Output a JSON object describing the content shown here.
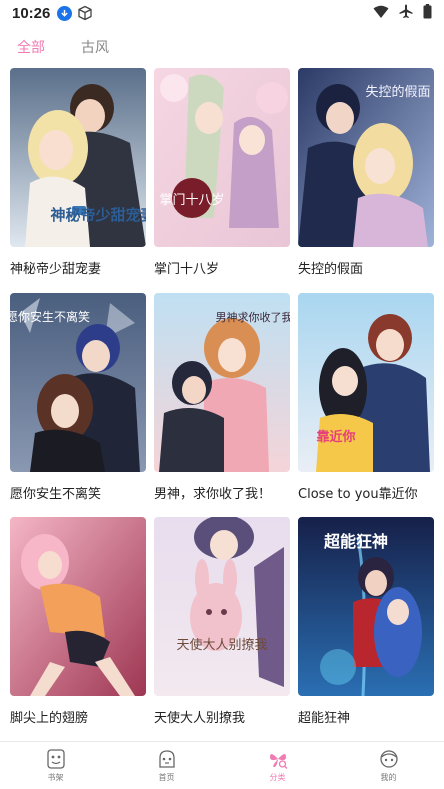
{
  "status_bar": {
    "time": "10:26",
    "icons": [
      "download-icon",
      "box-icon",
      "wifi-icon",
      "airplane-icon",
      "battery-icon"
    ]
  },
  "tabs": [
    {
      "label": "全部",
      "active": true
    },
    {
      "label": "古风",
      "active": false
    }
  ],
  "comics": [
    {
      "title": "神秘帝少甜宠妻",
      "cover_text": "神秘帝少甜宠妻"
    },
    {
      "title": "掌门十八岁",
      "cover_text": "掌门十八岁"
    },
    {
      "title": "失控的假面",
      "cover_text": "失控的假面"
    },
    {
      "title": "愿你安生不离笑",
      "cover_text": "愿你安生不离笑"
    },
    {
      "title": "男神，求你收了我！",
      "cover_text": "男神求你收了我"
    },
    {
      "title": "Close to you靠近你",
      "cover_text": "靠近你"
    },
    {
      "title": "脚尖上的翅膀",
      "cover_text": ""
    },
    {
      "title": "天使大人别撩我",
      "cover_text": "天使大人别撩我"
    },
    {
      "title": "超能狂神",
      "cover_text": "超能狂神"
    }
  ],
  "bottom_nav": [
    {
      "label": "书架",
      "icon": "bookshelf-icon",
      "active": false
    },
    {
      "label": "首页",
      "icon": "home-icon",
      "active": false
    },
    {
      "label": "分类",
      "icon": "category-icon",
      "active": true
    },
    {
      "label": "我的",
      "icon": "profile-icon",
      "active": false
    }
  ],
  "colors": {
    "accent": "#f07cb4",
    "text": "#222222",
    "muted": "#888888"
  }
}
